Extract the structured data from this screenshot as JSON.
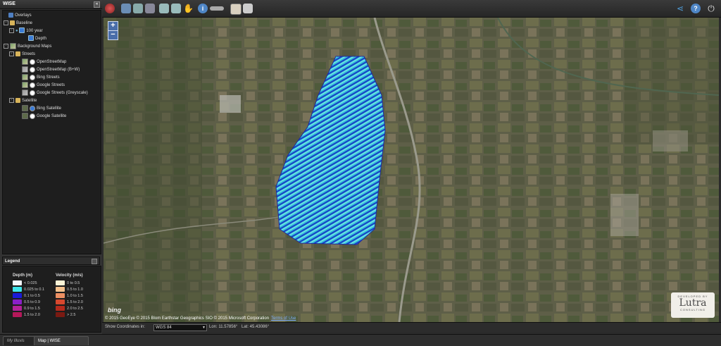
{
  "app": {
    "title": "WISE"
  },
  "tree": {
    "overlays": "Overlays",
    "baseline": "Baseline",
    "year100": "100 year",
    "depth": "Depth",
    "background_maps": "Background Maps",
    "streets": "Streets",
    "streets_items": [
      "OpenStreetMap",
      "OpenStreetMap (B+W)",
      "Bing Streets",
      "Google Streets",
      "Google Streets (Greyscale)"
    ],
    "satellite": "Satellite",
    "satellite_items": [
      "Bing Satellite",
      "Google Satellite"
    ]
  },
  "legend": {
    "title": "Legend",
    "depth_title": "Depth (m)",
    "depth_items": [
      {
        "label": "< 0.025",
        "color": "#f4f8ff"
      },
      {
        "label": "0.025 to 0.1",
        "color": "#3fe5ea"
      },
      {
        "label": "0.1 to 0.5",
        "color": "#1a1ad8"
      },
      {
        "label": "0.5 to 0.9",
        "color": "#8a1fc8"
      },
      {
        "label": "0.9 to 1.5",
        "color": "#b4229a"
      },
      {
        "label": "1.5 to 2.0",
        "color": "#b5185a"
      }
    ],
    "velocity_title": "Velocity (m/s)",
    "velocity_items": [
      {
        "label": "0 to 0.5",
        "color": "#fbf3d6"
      },
      {
        "label": "0.5 to 1.0",
        "color": "#f3c08c"
      },
      {
        "label": "1.0 to 1.5",
        "color": "#ec8f62"
      },
      {
        "label": "1.5 to 2.0",
        "color": "#d8482e"
      },
      {
        "label": "2.0 to 2.5",
        "color": "#b52a1c"
      },
      {
        "label": "> 2.5",
        "color": "#7a1a12"
      }
    ]
  },
  "map": {
    "attribution": "© 2015 GeoEye © 2015 Blom Earthstar Geographics SIO © 2015 Microsoft Corporation",
    "terms": "Terms of Use",
    "provider": "bing",
    "logo": {
      "top": "DEVELOPED BY",
      "name": "Lutra",
      "bottom": "CONSULTING"
    }
  },
  "coords": {
    "label": "Show Coordinates in:",
    "system": "WGS 84",
    "lon": "Lon: 11.57856°",
    "lat": "Lat: 45.43086°"
  },
  "tabs": [
    "My Illuvis",
    "Map | WISE"
  ]
}
